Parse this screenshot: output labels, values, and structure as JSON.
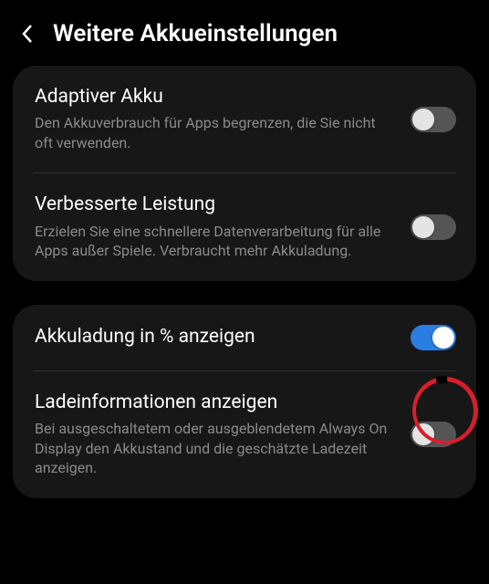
{
  "header": {
    "title": "Weitere Akkueinstellungen"
  },
  "sections": [
    {
      "items": [
        {
          "title": "Adaptiver Akku",
          "desc": "Den Akkuverbrauch für Apps begrenzen, die Sie nicht oft verwenden.",
          "toggle": "off"
        },
        {
          "title": "Verbesserte Leistung",
          "desc": "Erzielen Sie eine schnellere Datenverarbeitung für alle Apps außer Spiele. Verbraucht mehr Akkuladung.",
          "toggle": "off"
        }
      ]
    },
    {
      "items": [
        {
          "title": "Akkuladung in % anzeigen",
          "desc": null,
          "toggle": "on"
        },
        {
          "title": "Ladeinformationen anzeigen",
          "desc": "Bei ausgeschaltetem oder ausgeblendetem Always On Display den Akkustand und die geschätzte Ladezeit anzeigen.",
          "toggle": "off"
        }
      ]
    }
  ]
}
